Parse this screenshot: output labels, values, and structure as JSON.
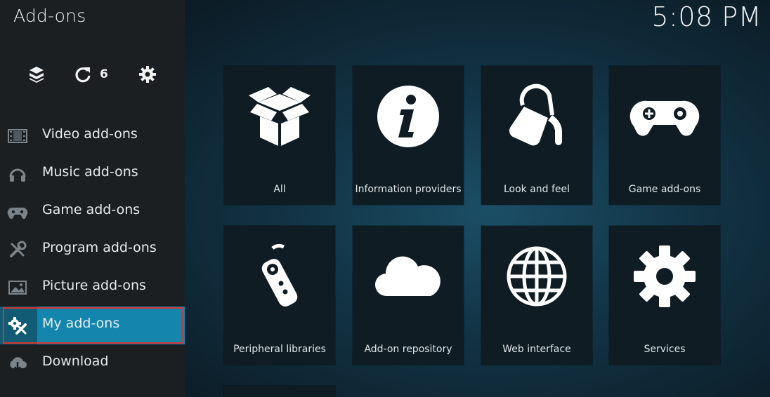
{
  "app": {
    "title": "Add-ons",
    "clock": "5:08 PM"
  },
  "toolbar": {
    "buttons": [
      {
        "icon": "box-icon"
      },
      {
        "icon": "refresh-icon",
        "count": "6"
      },
      {
        "icon": "gear-icon"
      }
    ]
  },
  "sidebar": {
    "items": [
      {
        "label": "Video add-ons",
        "icon": "film-icon"
      },
      {
        "label": "Music add-ons",
        "icon": "headphones-icon"
      },
      {
        "label": "Game add-ons",
        "icon": "gamepad-icon"
      },
      {
        "label": "Program add-ons",
        "icon": "tools-icon"
      },
      {
        "label": "Picture add-ons",
        "icon": "picture-icon"
      },
      {
        "label": "My add-ons",
        "icon": "my-addons-icon",
        "selected": true
      },
      {
        "label": "Download",
        "icon": "cloud-download-icon"
      }
    ]
  },
  "categories": [
    {
      "label": "All",
      "icon": "open-box-icon"
    },
    {
      "label": "Information providers",
      "icon": "info-icon"
    },
    {
      "label": "Look and feel",
      "icon": "paint-bucket-icon"
    },
    {
      "label": "Game add-ons",
      "icon": "gamepad-icon"
    },
    {
      "label": "Peripheral libraries",
      "icon": "remote-icon"
    },
    {
      "label": "Add-on repository",
      "icon": "cloud-icon"
    },
    {
      "label": "Web interface",
      "icon": "globe-icon"
    },
    {
      "label": "Services",
      "icon": "gear-icon"
    }
  ],
  "colors": {
    "accent": "#1486ad",
    "selection_outline": "#d9342b",
    "sidebar_bg": "#1b1f22",
    "tile_bg": "#0f1c24"
  }
}
